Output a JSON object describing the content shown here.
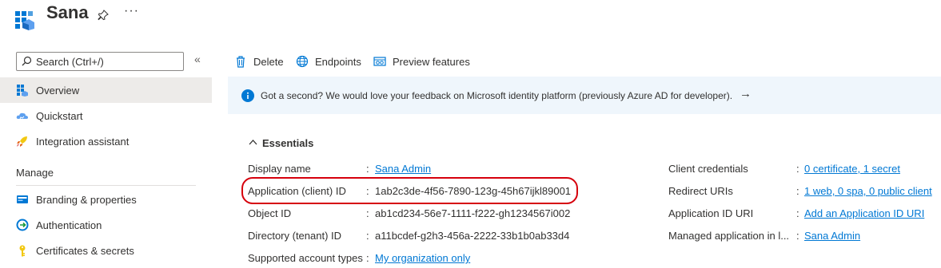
{
  "header": {
    "title": "Sana",
    "more": "···"
  },
  "sidebar": {
    "search_placeholder": "Search (Ctrl+/)",
    "collapse": "«",
    "items": [
      {
        "label": "Overview"
      },
      {
        "label": "Quickstart"
      },
      {
        "label": "Integration assistant"
      }
    ],
    "section_title": "Manage",
    "manage_items": [
      {
        "label": "Branding & properties"
      },
      {
        "label": "Authentication"
      },
      {
        "label": "Certificates & secrets"
      }
    ]
  },
  "toolbar": {
    "delete_label": "Delete",
    "endpoints_label": "Endpoints",
    "preview_label": "Preview features"
  },
  "banner": {
    "text": "Got a second? We would love your feedback on Microsoft identity platform (previously Azure AD for developer).",
    "arrow": "→"
  },
  "essentials": {
    "toggle_label": "Essentials",
    "left": [
      {
        "label": "Display name",
        "value": "Sana Admin",
        "link": true
      },
      {
        "label": "Application (client) ID",
        "value": "1ab2c3de-4f56-7890-123g-45h67ijkl89001",
        "link": false
      },
      {
        "label": "Object ID",
        "value": "ab1cd234-56e7-1111-f222-gh1234567i002",
        "link": false
      },
      {
        "label": "Directory (tenant) ID",
        "value": "a11bcdef-g2h3-456a-2222-33b1b0ab33d4",
        "link": false
      },
      {
        "label": "Supported account types",
        "value": "My organization only",
        "link": true
      }
    ],
    "right": [
      {
        "label": "Client credentials",
        "value": "0 certificate, 1 secret",
        "link": true
      },
      {
        "label": "Redirect URIs",
        "value": "1 web, 0 spa, 0 public client",
        "link": true
      },
      {
        "label": "Application ID URI",
        "value": "Add an Application ID URI",
        "link": true
      },
      {
        "label": "Managed application in l...",
        "value": "Sana Admin",
        "link": true
      }
    ]
  },
  "colors": {
    "accent": "#0078d4",
    "highlight": "#d6000c",
    "banner_bg": "#eff6fc",
    "active_nav_bg": "#edebe9"
  }
}
